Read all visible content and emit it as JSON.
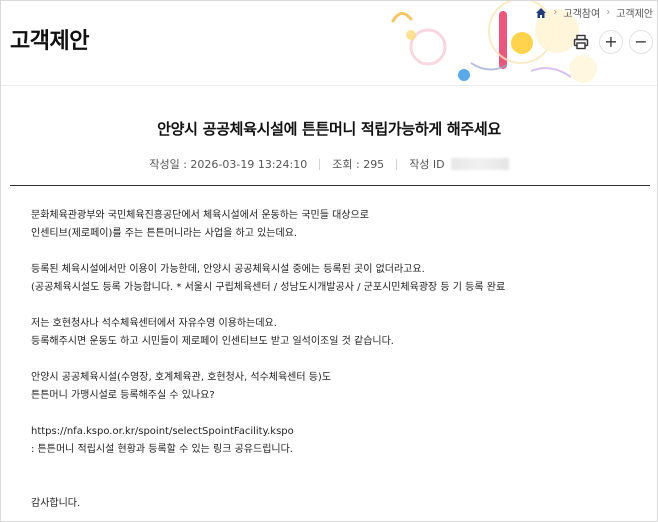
{
  "header": {
    "title": "고객제안",
    "breadcrumbs": [
      "고객참여",
      "고객제안"
    ],
    "tools": {
      "plus": "+",
      "minus": "−"
    }
  },
  "post": {
    "title": "안양시 공공체육시설에 튼튼머니 적립가능하게 해주세요",
    "meta": {
      "date_label": "작성일 : 2026-03-19 13:24:10",
      "views_label": "조회 : 295",
      "author_label": "작성 ID"
    },
    "body": [
      "문화체육관광부와 국민체육진흥공단에서 체육시설에서 운동하는 국민들 대상으로",
      "인센티브(제로페이)를 주는 튼튼머니라는 사업을 하고 있는데요.",
      "",
      "등록된 체육시설에서만 이용이 가능한데, 안양시 공공체육시설 중에는 등록된 곳이 없더라고요.",
      "(공공체육시설도 등록 가능합니다.  * 서울시 구립체육센터  / 성남도시개발공사 / 군포시민체육광장 등 기 등록 완료",
      "",
      "저는 호현청사나 석수체육센터에서 자유수영 이용하는데요.",
      "등록해주시면 운동도 하고 시민들이 제로페이 인센티브도 받고 일석이조일 것 같습니다.",
      "",
      "안양시 공공체육시설(수영장, 호계체육관, 호현청사, 석수체육센터 등)도",
      "튼튼머니 가맹시설로 등록해주실 수 있나요?",
      "",
      "https://nfa.kspo.or.kr/spoint/selectSpointFacility.kspo",
      ": 튼튼머니 적립시설 현황과 등록할 수 있는 링크 공유드립니다.",
      "",
      "",
      "감사합니다."
    ]
  }
}
